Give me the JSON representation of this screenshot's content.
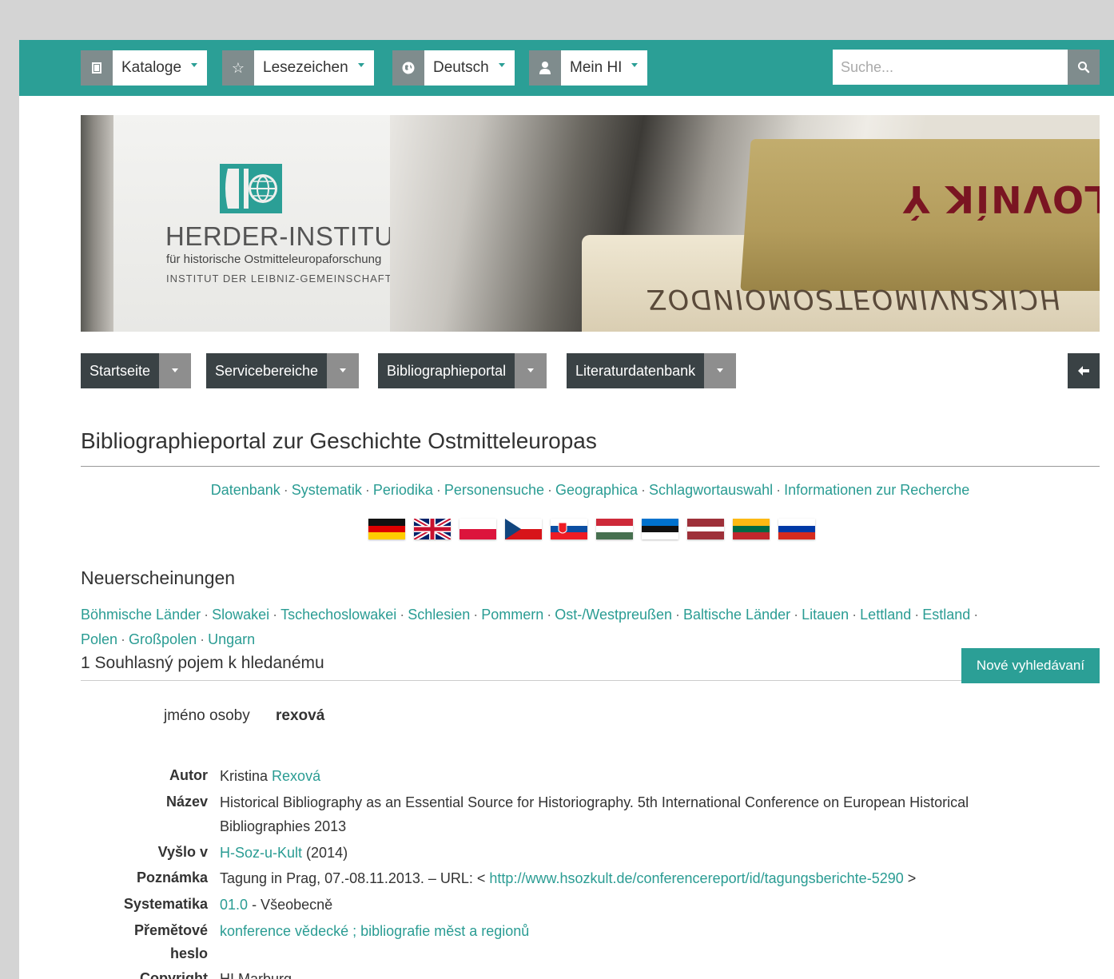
{
  "topbar": {
    "catalogs_label": "Kataloge",
    "bookmarks_label": "Lesezeichen",
    "language_label": "Deutsch",
    "account_label": "Mein HI",
    "search_placeholder": "Suche..."
  },
  "banner": {
    "title": "HERDER-INSTITUT",
    "subtitle1": "für historische Ostmitteleuropaforschung",
    "subtitle2": "INSTITUT DER LEIBNIZ-GEMEINSCHAFT",
    "spine_text_1": "SLOVNÍK Ý",
    "spine_text_2": "HCIKSNVIMOƎTSOMOINDOZ"
  },
  "nav": [
    "Startseite",
    "Servicebereiche",
    "Bibliographieportal",
    "Literaturdatenbank"
  ],
  "page_title": "Bibliographieportal zur Geschichte Ostmitteleuropas",
  "sublinks": [
    "Datenbank",
    "Systematik",
    "Periodika",
    "Personensuche",
    "Geographica",
    "Schlagwortauswahl",
    "Informationen zur Recherche"
  ],
  "flags": [
    "germany",
    "united-kingdom",
    "poland",
    "czech-republic",
    "slovakia",
    "hungary",
    "estonia",
    "latvia",
    "lithuania",
    "russia"
  ],
  "new_heading": "Neuerscheinungen",
  "regions": [
    "Böhmische Länder",
    "Slowakei",
    "Tschechoslowakei",
    "Schlesien",
    "Pommern",
    "Ost-/Westpreußen",
    "Baltische Länder",
    "Litauen",
    "Lettland",
    "Estland",
    "Polen",
    "Großpolen",
    "Ungarn"
  ],
  "result": {
    "count_text": "1 Souhlasný pojem k hledanému",
    "new_search_label": "Nové vyhledávaní",
    "query_label": "jméno osoby",
    "query_value": "rexová"
  },
  "record": {
    "author_label": "Autor",
    "author_first": "Kristina",
    "author_last": "Rexová",
    "title_label": "Název",
    "title_value": "Historical Bibliography as an Essential Source for Historiography. 5th International Conference on European Historical Bibliographies 2013",
    "published_label": "Vyšlo v",
    "published_link": "H-Soz-u-Kult",
    "published_year": "(2014)",
    "note_label": "Poznámka",
    "note_text": "Tagung in Prag, 07.-08.11.2013. – URL: <",
    "note_url": "http://www.hsozkult.de/conferencereport/id/tagungsberichte-5290",
    "note_end": ">",
    "system_label": "Systematika",
    "system_code": "01.0",
    "system_text": "- Všeobecně",
    "subject_label_1": "Přemětové",
    "subject_label_2": "heslo",
    "subject_1": "konference vědecké",
    "subject_sep": ";",
    "subject_2": "bibliografie měst a regionů",
    "copyright_label": "Copyright",
    "copyright_value": "HI Marburg"
  },
  "colors": {
    "accent": "#2b9f96",
    "nav_dark": "#3a4245",
    "icon_grey": "#7f8c8d"
  }
}
